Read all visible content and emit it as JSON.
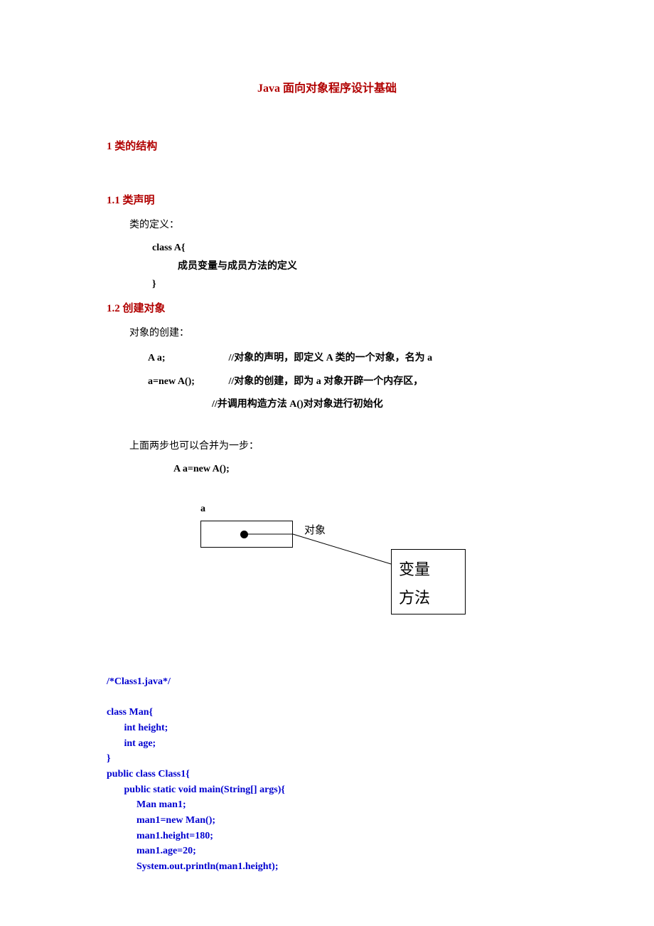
{
  "title": "Java 面向对象程序设计基础",
  "sec1": "1  类的结构",
  "sec11": "1.1  类声明",
  "sec12": "1.2  创建对象",
  "para_def": "类的定义：",
  "def_l1": "class A{",
  "def_l2": "成员变量与成员方法的定义",
  "def_l3": "}",
  "para_obj": "对象的创建：",
  "obj_l1a": "A a;",
  "obj_l1b": "//对象的声明，即定义 A 类的一个对象，名为 a",
  "obj_l2a": "a=new A();",
  "obj_l2b": "//对象的创建，即为 a 对象开辟一个内存区，",
  "obj_l3": "//并调用构造方法 A()对对象进行初始化",
  "para_merge": "上面两步也可以合并为一步：",
  "merge_code": "A a=new A();",
  "diag": {
    "a": "a",
    "obj": "对象",
    "var": "变量",
    "method": "方法"
  },
  "code": {
    "c1": "/*Class1.java*/",
    "c2": "class Man{",
    "c3": "       int height;",
    "c4": "       int age;",
    "c5": "}",
    "c6": "public class Class1{",
    "c7": "       public static void main(String[] args){",
    "c8": "            Man man1;",
    "c9": "            man1=new Man();",
    "c10": "            man1.height=180;",
    "c11": "            man1.age=20;",
    "c12": "            System.out.println(man1.height);"
  }
}
